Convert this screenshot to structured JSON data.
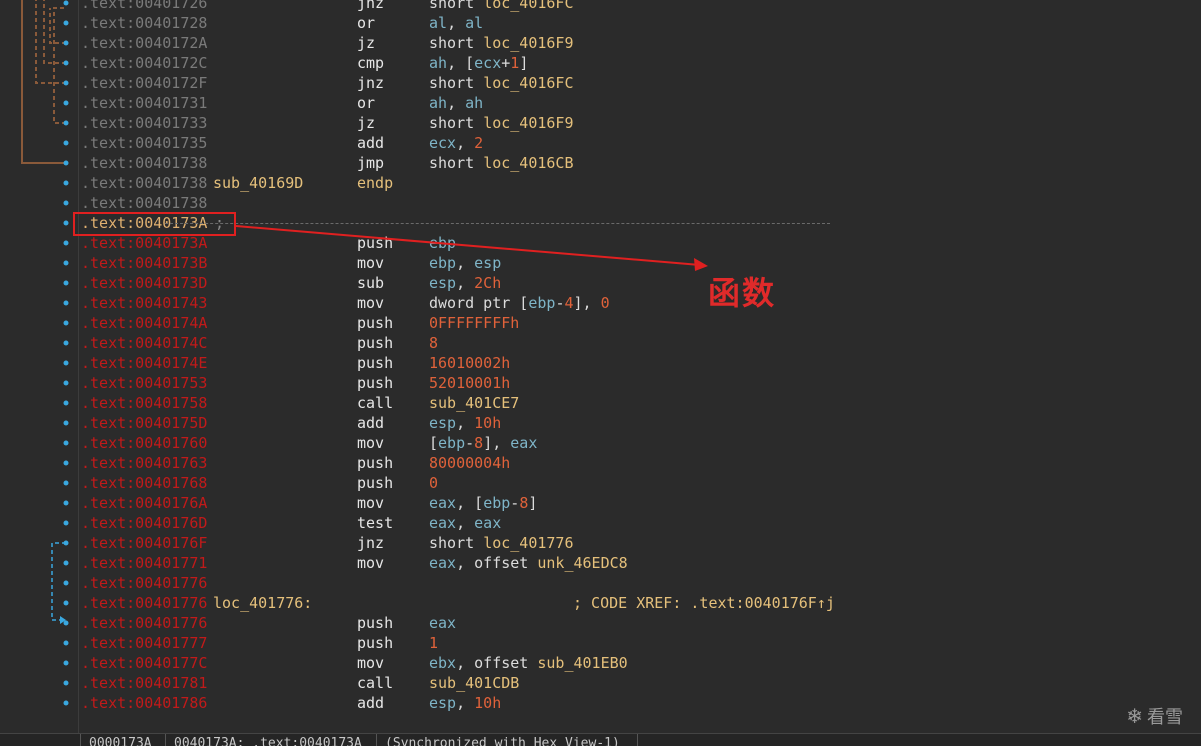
{
  "listing": [
    {
      "addr": ".text:00401726",
      "addr_style": "grey",
      "label": "",
      "mnem": "jnz",
      "ops": [
        {
          "t": "kw",
          "v": "short "
        },
        {
          "t": "sym",
          "v": "loc_4016FC"
        }
      ]
    },
    {
      "addr": ".text:00401728",
      "addr_style": "grey",
      "label": "",
      "mnem": "or",
      "ops": [
        {
          "t": "reg",
          "v": "al"
        },
        {
          "t": "kw",
          "v": ", "
        },
        {
          "t": "reg",
          "v": "al"
        }
      ]
    },
    {
      "addr": ".text:0040172A",
      "addr_style": "grey",
      "label": "",
      "mnem": "jz",
      "ops": [
        {
          "t": "kw",
          "v": "short "
        },
        {
          "t": "sym",
          "v": "loc_4016F9"
        }
      ]
    },
    {
      "addr": ".text:0040172C",
      "addr_style": "grey",
      "label": "",
      "mnem": "cmp",
      "ops": [
        {
          "t": "reg",
          "v": "ah"
        },
        {
          "t": "kw",
          "v": ", ["
        },
        {
          "t": "reg",
          "v": "ecx"
        },
        {
          "t": "kw",
          "v": "+"
        },
        {
          "t": "num",
          "v": "1"
        },
        {
          "t": "kw",
          "v": "]"
        }
      ]
    },
    {
      "addr": ".text:0040172F",
      "addr_style": "grey",
      "label": "",
      "mnem": "jnz",
      "ops": [
        {
          "t": "kw",
          "v": "short "
        },
        {
          "t": "sym",
          "v": "loc_4016FC"
        }
      ]
    },
    {
      "addr": ".text:00401731",
      "addr_style": "grey",
      "label": "",
      "mnem": "or",
      "ops": [
        {
          "t": "reg",
          "v": "ah"
        },
        {
          "t": "kw",
          "v": ", "
        },
        {
          "t": "reg",
          "v": "ah"
        }
      ]
    },
    {
      "addr": ".text:00401733",
      "addr_style": "grey",
      "label": "",
      "mnem": "jz",
      "ops": [
        {
          "t": "kw",
          "v": "short "
        },
        {
          "t": "sym",
          "v": "loc_4016F9"
        }
      ]
    },
    {
      "addr": ".text:00401735",
      "addr_style": "grey",
      "label": "",
      "mnem": "add",
      "ops": [
        {
          "t": "reg",
          "v": "ecx"
        },
        {
          "t": "kw",
          "v": ", "
        },
        {
          "t": "num",
          "v": "2"
        }
      ]
    },
    {
      "addr": ".text:00401738",
      "addr_style": "grey",
      "label": "",
      "mnem": "jmp",
      "ops": [
        {
          "t": "kw",
          "v": "short "
        },
        {
          "t": "sym",
          "v": "loc_4016CB"
        }
      ]
    },
    {
      "addr": ".text:00401738",
      "addr_style": "grey",
      "label": "sub_40169D",
      "mnem": "endp",
      "mnem_style": "sym",
      "ops": []
    },
    {
      "addr": ".text:00401738",
      "addr_style": "grey",
      "label": "",
      "mnem": "",
      "ops": []
    },
    {
      "addr": ".text:0040173A",
      "addr_style": "boxed",
      "label": "",
      "mnem": "",
      "ops": [],
      "semicolon": ";"
    },
    {
      "addr": ".text:0040173A",
      "addr_style": "red",
      "label": "",
      "mnem": "push",
      "ops": [
        {
          "t": "reg",
          "v": "ebp"
        }
      ]
    },
    {
      "addr": ".text:0040173B",
      "addr_style": "red",
      "label": "",
      "mnem": "mov",
      "ops": [
        {
          "t": "reg",
          "v": "ebp"
        },
        {
          "t": "kw",
          "v": ", "
        },
        {
          "t": "reg",
          "v": "esp"
        }
      ]
    },
    {
      "addr": ".text:0040173D",
      "addr_style": "red",
      "label": "",
      "mnem": "sub",
      "ops": [
        {
          "t": "reg",
          "v": "esp"
        },
        {
          "t": "kw",
          "v": ", "
        },
        {
          "t": "num",
          "v": "2Ch"
        }
      ]
    },
    {
      "addr": ".text:00401743",
      "addr_style": "red",
      "label": "",
      "mnem": "mov",
      "ops": [
        {
          "t": "kw",
          "v": "dword ptr ["
        },
        {
          "t": "reg",
          "v": "ebp"
        },
        {
          "t": "kw",
          "v": "-"
        },
        {
          "t": "num",
          "v": "4"
        },
        {
          "t": "kw",
          "v": "], "
        },
        {
          "t": "num",
          "v": "0"
        }
      ]
    },
    {
      "addr": ".text:0040174A",
      "addr_style": "red",
      "label": "",
      "mnem": "push",
      "ops": [
        {
          "t": "num",
          "v": "0FFFFFFFFh"
        }
      ]
    },
    {
      "addr": ".text:0040174C",
      "addr_style": "red",
      "label": "",
      "mnem": "push",
      "ops": [
        {
          "t": "num",
          "v": "8"
        }
      ]
    },
    {
      "addr": ".text:0040174E",
      "addr_style": "red",
      "label": "",
      "mnem": "push",
      "ops": [
        {
          "t": "num",
          "v": "16010002h"
        }
      ]
    },
    {
      "addr": ".text:00401753",
      "addr_style": "red",
      "label": "",
      "mnem": "push",
      "ops": [
        {
          "t": "num",
          "v": "52010001h"
        }
      ]
    },
    {
      "addr": ".text:00401758",
      "addr_style": "red",
      "label": "",
      "mnem": "call",
      "ops": [
        {
          "t": "sym",
          "v": "sub_401CE7"
        }
      ]
    },
    {
      "addr": ".text:0040175D",
      "addr_style": "red",
      "label": "",
      "mnem": "add",
      "ops": [
        {
          "t": "reg",
          "v": "esp"
        },
        {
          "t": "kw",
          "v": ", "
        },
        {
          "t": "num",
          "v": "10h"
        }
      ]
    },
    {
      "addr": ".text:00401760",
      "addr_style": "red",
      "label": "",
      "mnem": "mov",
      "ops": [
        {
          "t": "kw",
          "v": "["
        },
        {
          "t": "reg",
          "v": "ebp"
        },
        {
          "t": "kw",
          "v": "-"
        },
        {
          "t": "num",
          "v": "8"
        },
        {
          "t": "kw",
          "v": "], "
        },
        {
          "t": "reg",
          "v": "eax"
        }
      ]
    },
    {
      "addr": ".text:00401763",
      "addr_style": "red",
      "label": "",
      "mnem": "push",
      "ops": [
        {
          "t": "num",
          "v": "80000004h"
        }
      ]
    },
    {
      "addr": ".text:00401768",
      "addr_style": "red",
      "label": "",
      "mnem": "push",
      "ops": [
        {
          "t": "num",
          "v": "0"
        }
      ]
    },
    {
      "addr": ".text:0040176A",
      "addr_style": "red",
      "label": "",
      "mnem": "mov",
      "ops": [
        {
          "t": "reg",
          "v": "eax"
        },
        {
          "t": "kw",
          "v": ", ["
        },
        {
          "t": "reg",
          "v": "ebp"
        },
        {
          "t": "kw",
          "v": "-"
        },
        {
          "t": "num",
          "v": "8"
        },
        {
          "t": "kw",
          "v": "]"
        }
      ]
    },
    {
      "addr": ".text:0040176D",
      "addr_style": "red",
      "label": "",
      "mnem": "test",
      "ops": [
        {
          "t": "reg",
          "v": "eax"
        },
        {
          "t": "kw",
          "v": ", "
        },
        {
          "t": "reg",
          "v": "eax"
        }
      ]
    },
    {
      "addr": ".text:0040176F",
      "addr_style": "red",
      "label": "",
      "mnem": "jnz",
      "ops": [
        {
          "t": "kw",
          "v": "short "
        },
        {
          "t": "sym",
          "v": "loc_401776"
        }
      ]
    },
    {
      "addr": ".text:00401771",
      "addr_style": "red",
      "label": "",
      "mnem": "mov",
      "ops": [
        {
          "t": "reg",
          "v": "eax"
        },
        {
          "t": "kw",
          "v": ", offset "
        },
        {
          "t": "sym",
          "v": "unk_46EDC8"
        }
      ]
    },
    {
      "addr": ".text:00401776",
      "addr_style": "red",
      "label": "",
      "mnem": "",
      "ops": []
    },
    {
      "addr": ".text:00401776",
      "addr_style": "red",
      "label": "loc_401776:",
      "mnem": "",
      "ops": [],
      "comment": "; CODE XREF: .text:0040176F↑j"
    },
    {
      "addr": ".text:00401776",
      "addr_style": "red",
      "label": "",
      "mnem": "push",
      "ops": [
        {
          "t": "reg",
          "v": "eax"
        }
      ]
    },
    {
      "addr": ".text:00401777",
      "addr_style": "red",
      "label": "",
      "mnem": "push",
      "ops": [
        {
          "t": "num",
          "v": "1"
        }
      ]
    },
    {
      "addr": ".text:0040177C",
      "addr_style": "red",
      "label": "",
      "mnem": "mov",
      "ops": [
        {
          "t": "reg",
          "v": "ebx"
        },
        {
          "t": "kw",
          "v": ", offset "
        },
        {
          "t": "sym",
          "v": "sub_401EB0"
        }
      ]
    },
    {
      "addr": ".text:00401781",
      "addr_style": "red",
      "label": "",
      "mnem": "call",
      "ops": [
        {
          "t": "sym",
          "v": "sub_401CDB"
        }
      ]
    },
    {
      "addr": ".text:00401786",
      "addr_style": "red",
      "label": "",
      "mnem": "add",
      "ops": [
        {
          "t": "reg",
          "v": "esp"
        },
        {
          "t": "kw",
          "v": ", "
        },
        {
          "t": "num",
          "v": "10h"
        }
      ]
    }
  ],
  "annotation": {
    "text": "函数",
    "color": "#e02a2a"
  },
  "status_bar": {
    "offset": "0000173A",
    "location": "0040173A: .text:0040173A",
    "sync": "(Synchronized with Hex View-1)"
  },
  "watermark": {
    "icon": "snowflake-icon",
    "text": "看雪"
  },
  "colors": {
    "background": "#2b2b2b",
    "address_grey": "#7a7a7a",
    "address_red": "#c11a1a",
    "symbol_yellow": "#e5c07b",
    "register_cyan": "#7fb5c8",
    "number_orange": "#e0623a",
    "annotation_red": "#e02020"
  }
}
